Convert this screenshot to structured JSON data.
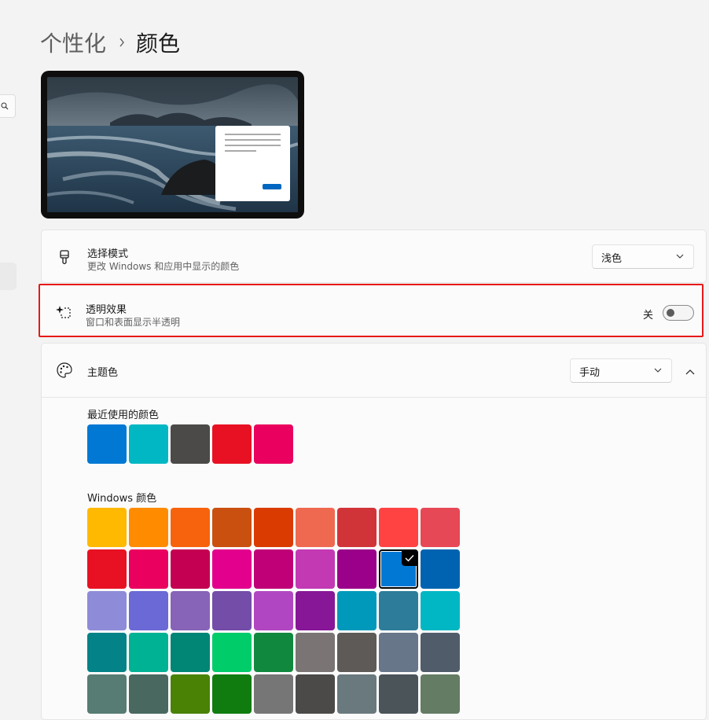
{
  "breadcrumb": {
    "parent": "个性化",
    "current": "颜色"
  },
  "mode": {
    "title": "选择模式",
    "subtitle": "更改 Windows 和应用中显示的颜色",
    "value": "浅色"
  },
  "transparency": {
    "title": "透明效果",
    "subtitle": "窗口和表面显示半透明",
    "state_label": "关",
    "on": false
  },
  "accent": {
    "title": "主题色",
    "value": "手动",
    "recent_label": "最近使用的颜色",
    "recent_colors": [
      "#0078d4",
      "#00b7c3",
      "#4c4a48",
      "#e81123",
      "#ea005e"
    ],
    "windows_label": "Windows 颜色",
    "selected_color": "#0078d4",
    "windows_colors": [
      "#ffb900",
      "#ff8c00",
      "#f7630c",
      "#ca5010",
      "#da3b01",
      "#ef6950",
      "#d13438",
      "#ff4343",
      "#e74856",
      "#e81123",
      "#ea005e",
      "#c30052",
      "#e3008c",
      "#bf0077",
      "#c239b3",
      "#9a0089",
      "#0078d4",
      "#0063b1",
      "#8e8cd8",
      "#6b69d6",
      "#8764b8",
      "#744da9",
      "#b146c2",
      "#881798",
      "#0099bc",
      "#2d7d9a",
      "#00b7c3",
      "#038387",
      "#00b294",
      "#018574",
      "#00cc6a",
      "#10893e",
      "#7a7574",
      "#5d5a58",
      "#68768a",
      "#515c6b",
      "#567c73",
      "#486860",
      "#498205",
      "#107c10",
      "#767676",
      "#4c4a48",
      "#69797e",
      "#4a5459",
      "#647c64"
    ]
  }
}
